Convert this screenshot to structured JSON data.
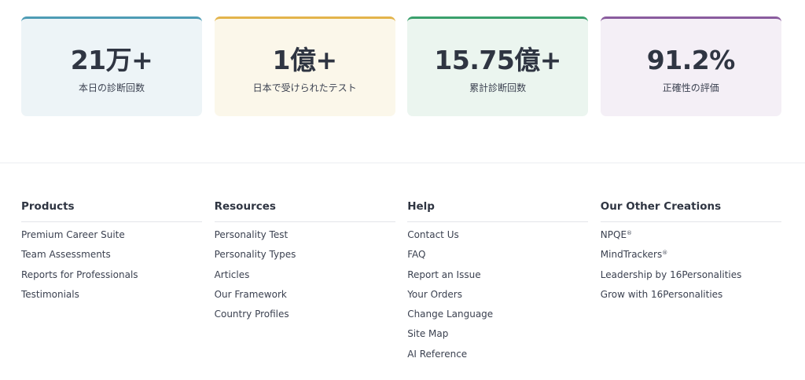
{
  "stats": [
    {
      "value": "21万+",
      "label": "本日の診断回数"
    },
    {
      "value": "1億+",
      "label": "日本で受けられたテスト"
    },
    {
      "value": "15.75億+",
      "label": "累計診断回数"
    },
    {
      "value": "91.2%",
      "label": "正確性の評価"
    }
  ],
  "colors": {
    "card1_accent": "#4e9cb5",
    "card2_accent": "#e3b44b",
    "card3_accent": "#3aa06c",
    "card4_accent": "#8a5c9e"
  },
  "footer": {
    "products": {
      "title": "Products",
      "items": [
        "Premium Career Suite",
        "Team Assessments",
        "Reports for Professionals",
        "Testimonials"
      ]
    },
    "resources": {
      "title": "Resources",
      "items": [
        "Personality Test",
        "Personality Types",
        "Articles",
        "Our Framework",
        "Country Profiles"
      ]
    },
    "help": {
      "title": "Help",
      "items": [
        "Contact Us",
        "FAQ",
        "Report an Issue",
        "Your Orders",
        "Change Language",
        "Site Map",
        "AI Reference"
      ]
    },
    "other": {
      "title": "Our Other Creations",
      "items": [
        "NPQE",
        "MindTrackers",
        "Leadership by 16Personalities",
        "Grow with 16Personalities"
      ],
      "reg_mark": "®"
    }
  }
}
